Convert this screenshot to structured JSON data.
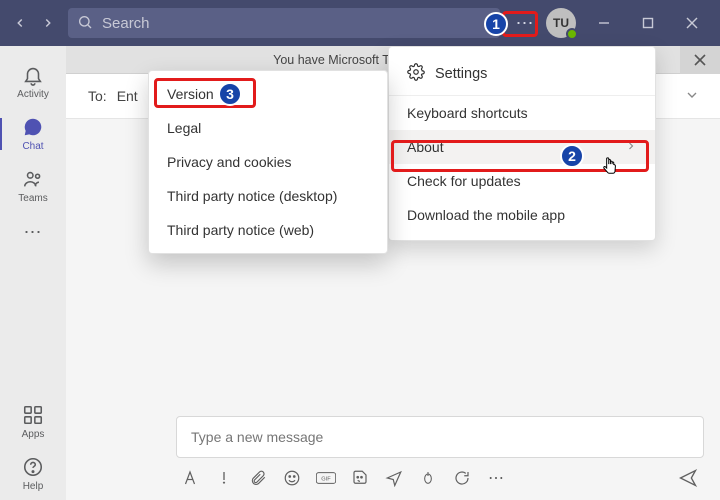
{
  "search": {
    "placeholder": "Search"
  },
  "avatar": {
    "initials": "TU"
  },
  "rail": {
    "activity": "Activity",
    "chat": "Chat",
    "teams": "Teams",
    "apps": "Apps",
    "help": "Help"
  },
  "banner": {
    "text": "You have Microsoft Teams Version 1.4.00.1"
  },
  "toRow": {
    "label": "To:",
    "value": "Ent"
  },
  "composer": {
    "placeholder": "Type a new message"
  },
  "dropdown": {
    "settings": "Settings",
    "keyboard": "Keyboard shortcuts",
    "about": "About",
    "check": "Check for updates",
    "download": "Download the mobile app"
  },
  "flyout": {
    "version": "Version",
    "legal": "Legal",
    "privacy": "Privacy and cookies",
    "tpn_desktop": "Third party notice (desktop)",
    "tpn_web": "Third party notice (web)"
  },
  "annotations": {
    "n1": "1",
    "n2": "2",
    "n3": "3"
  }
}
